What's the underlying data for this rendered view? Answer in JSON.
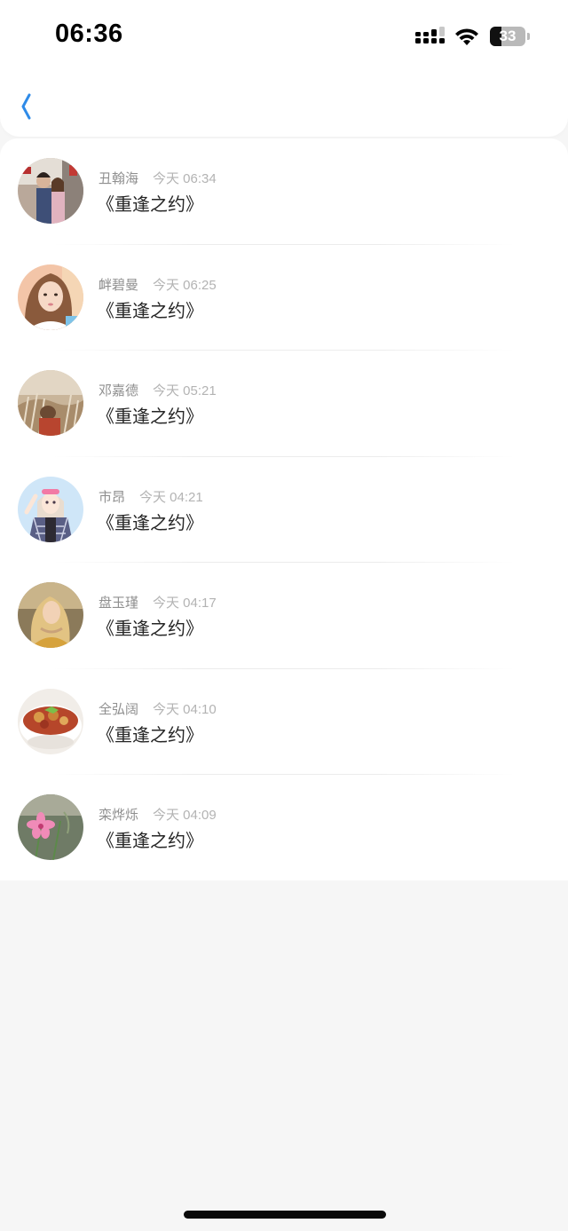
{
  "status_bar": {
    "time": "06:36",
    "battery_level": 33,
    "battery_label": "33"
  },
  "nav": {
    "back_icon": "chevron-left-icon",
    "accent_color": "#2f8be8"
  },
  "list": {
    "items": [
      {
        "name": "丑翰海",
        "time": "今天 06:34",
        "text": "《重逢之约》",
        "avatar": "couple-street-photo"
      },
      {
        "name": "衅碧曼",
        "time": "今天 06:25",
        "text": "《重逢之约》",
        "avatar": "girl-selfie-photo"
      },
      {
        "name": "邓嘉德",
        "time": "今天 05:21",
        "text": "《重逢之约》",
        "avatar": "person-in-grass-photo"
      },
      {
        "name": "市昂",
        "time": "今天 04:21",
        "text": "《重逢之约》",
        "avatar": "anime-girl-illustration"
      },
      {
        "name": "盘玉瑾",
        "time": "今天 04:17",
        "text": "《重逢之约》",
        "avatar": "blonde-girl-photo"
      },
      {
        "name": "全弘阔",
        "time": "今天 04:10",
        "text": "《重逢之约》",
        "avatar": "food-bowl-photo"
      },
      {
        "name": "栾烨烁",
        "time": "今天 04:09",
        "text": "《重逢之约》",
        "avatar": "pink-flower-photo"
      }
    ]
  }
}
